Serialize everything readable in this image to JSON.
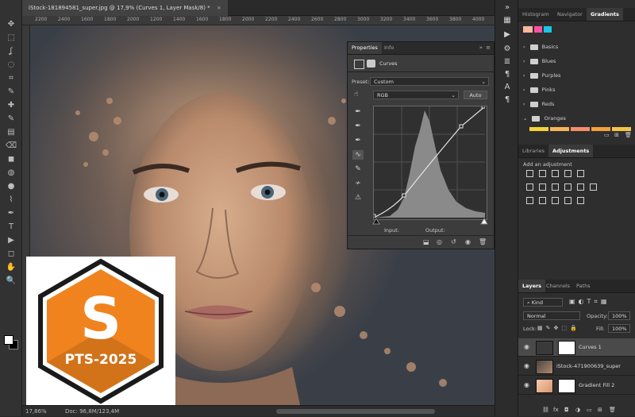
{
  "document": {
    "tab_title": "iStock-181894581_super.jpg @ 17,9% (Curves 1, Layer Mask/8) *",
    "close_glyph": "×",
    "ruler_ticks": [
      "2200",
      "2400",
      "1600",
      "1800",
      "2000",
      "1200",
      "1400",
      "1600",
      "1800",
      "2000",
      "2200",
      "2400",
      "2600",
      "2800",
      "3000",
      "3200",
      "3400",
      "3600",
      "3800",
      "4000"
    ]
  },
  "status": {
    "zoom": "17,86%",
    "doc_size": "Doc: 96,8M/123,4M"
  },
  "promo": {
    "letter": "S",
    "label": "PTS-2025",
    "hex_color": "#f0831e"
  },
  "tools": [
    "✥",
    "⬚",
    "ʆ",
    "◌",
    "⌗",
    "✎",
    "✚",
    "✎",
    "▤",
    "⌫",
    "◼",
    "◍",
    "●",
    "⌇",
    "✒",
    "T",
    "▶",
    "◻",
    "✋",
    "🔍"
  ],
  "properties": {
    "tabs": {
      "properties": "Properties",
      "info": "Info"
    },
    "panel_name": "Curves",
    "preset_label": "Preset:",
    "preset_value": "Custom",
    "channel_value": "RGB",
    "auto_label": "Auto",
    "input_label": "Input:",
    "output_label": "Output:"
  },
  "top_panel": {
    "tabs": {
      "histogram": "Histogram",
      "navigator": "Navigator",
      "gradients": "Gradients"
    },
    "gradient_groups": [
      "Basics",
      "Blues",
      "Purples",
      "Pinks",
      "Reds",
      "Oranges"
    ]
  },
  "adjust_panel": {
    "tabs": {
      "libraries": "Libraries",
      "adjustments": "Adjustments"
    },
    "hint": "Add an adjustment"
  },
  "layers_panel": {
    "tabs": {
      "layers": "Layers",
      "channels": "Channels",
      "paths": "Paths"
    },
    "filter_value": "Kind",
    "blend_mode": "Normal",
    "opacity_label": "Opacity:",
    "opacity_value": "100%",
    "lock_label": "Lock:",
    "fill_label": "Fill:",
    "fill_value": "100%",
    "layers": [
      {
        "name": "Curves 1"
      },
      {
        "name": "iStock-471900639_super"
      },
      {
        "name": "Gradient Fill 2"
      }
    ]
  }
}
